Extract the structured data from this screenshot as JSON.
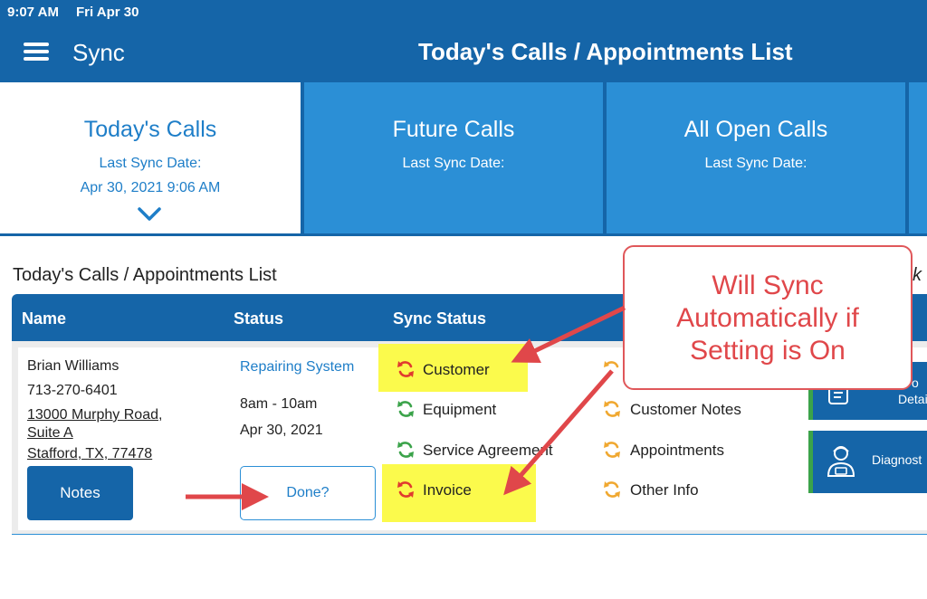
{
  "status_bar": {
    "time": "9:07 AM",
    "date": "Fri Apr 30"
  },
  "nav": {
    "app_title": "Sync",
    "screen_title": "Today's Calls / Appointments List"
  },
  "tabs": [
    {
      "title": "Today's Calls",
      "sync_label": "Last Sync Date:",
      "sync_date": "Apr 30, 2021 9:06 AM",
      "active": true
    },
    {
      "title": "Future Calls",
      "sync_label": "Last Sync Date:",
      "sync_date": ""
    },
    {
      "title": "All Open Calls",
      "sync_label": "Last Sync Date:",
      "sync_date": ""
    }
  ],
  "list": {
    "title": "Today's Calls / Appointments List",
    "title_cut": "k",
    "columns": [
      "Name",
      "Status",
      "Sync Status"
    ]
  },
  "call": {
    "name": "Brian Williams",
    "phone": "713-270-6401",
    "address_line1": "13000 Murphy Road,",
    "address_line2": "Suite A",
    "address_line3": "Stafford, TX, 77478",
    "notes_button": "Notes",
    "status": "Repairing System",
    "time_window": "8am - 10am",
    "date": "Apr 30, 2021",
    "done_button": "Done?"
  },
  "sync_items": {
    "col1": [
      {
        "label": "Customer",
        "state": "pending-red",
        "highlighted": true
      },
      {
        "label": "Equipment",
        "state": "synced-green",
        "highlighted": false
      },
      {
        "label": "Service Agreement",
        "state": "synced-green",
        "highlighted": false
      },
      {
        "label": "Invoice",
        "state": "pending-red",
        "highlighted": true
      }
    ],
    "col2": [
      {
        "label": "",
        "state": "orange"
      },
      {
        "label": "Customer Notes",
        "state": "orange"
      },
      {
        "label": "Appointments",
        "state": "orange"
      },
      {
        "label": "Other Info",
        "state": "orange"
      }
    ]
  },
  "side_buttons": [
    {
      "label_line1": "o",
      "label_line2": "Detai",
      "icon": "clipboard-icon"
    },
    {
      "label_line1": "Diagnost",
      "icon": "technician-icon"
    }
  ],
  "annotation": {
    "line1": "Will Sync",
    "line2": "Automatically if",
    "line3": "Setting is On"
  },
  "colors": {
    "primary_dark": "#1565a8",
    "primary": "#2b8fd6",
    "link": "#1e7ec8",
    "highlight": "#fbfa4c",
    "callout": "#e0474a",
    "sync_red": "#e03a2f",
    "sync_green": "#3ba34a",
    "sync_orange": "#f0a830"
  }
}
